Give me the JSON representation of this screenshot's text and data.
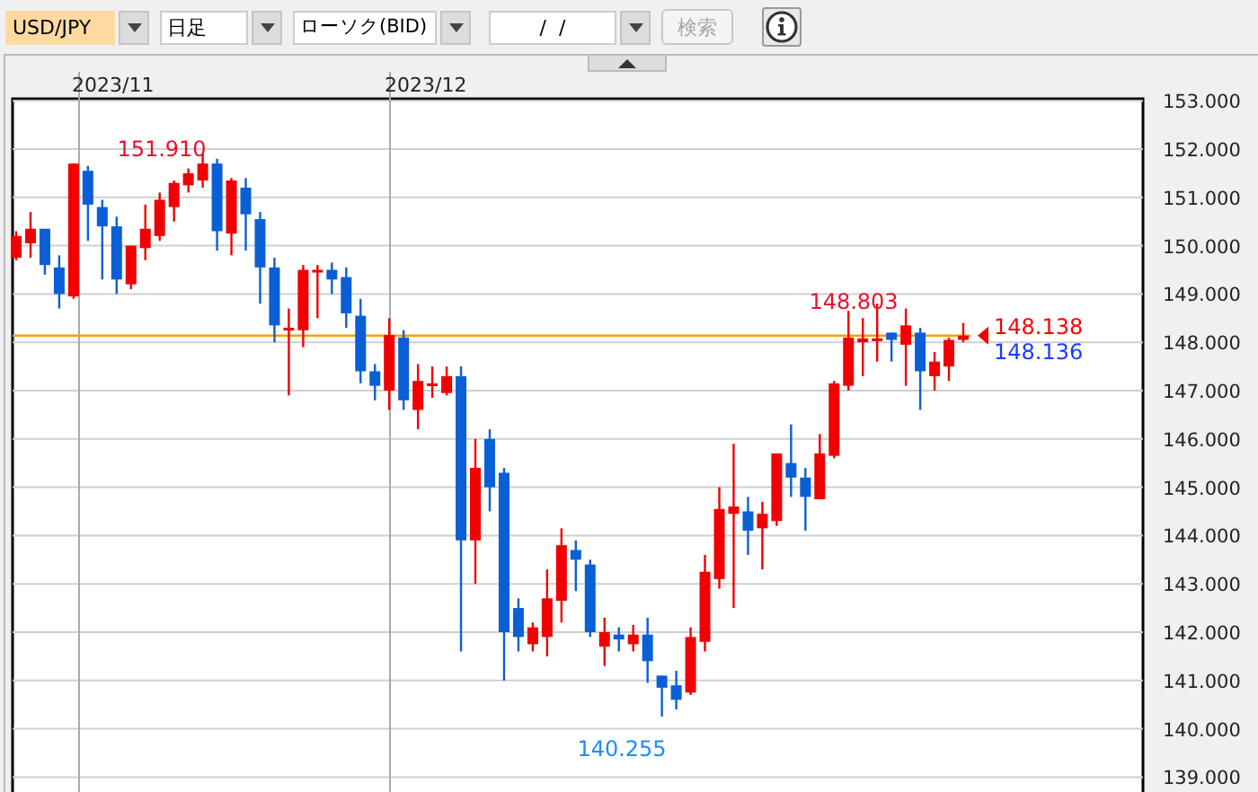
{
  "toolbar": {
    "symbol": {
      "value": "USD/JPY",
      "highlighted": true
    },
    "timeframe": {
      "value": "日足"
    },
    "chart_type": {
      "value": "ローソク(BID)"
    },
    "date": {
      "value": "/  /"
    },
    "search_button": {
      "label": "検索",
      "disabled": true
    }
  },
  "chart": {
    "date_labels": [
      "2023/11",
      "2023/12"
    ],
    "price_axis": [
      "153.000",
      "152.000",
      "151.000",
      "150.000",
      "149.000",
      "148.000",
      "147.000",
      "146.000",
      "145.000",
      "144.000",
      "143.000",
      "142.000",
      "141.000",
      "140.000",
      "139.000"
    ],
    "annotations": [
      {
        "text": "151.910",
        "kind": "high"
      },
      {
        "text": "148.803",
        "kind": "high"
      },
      {
        "text": "140.255",
        "kind": "low"
      }
    ],
    "current_prices": [
      {
        "text": "148.138",
        "color": "#ff0000"
      },
      {
        "text": "148.136",
        "color": "#1a3cff"
      }
    ]
  }
}
